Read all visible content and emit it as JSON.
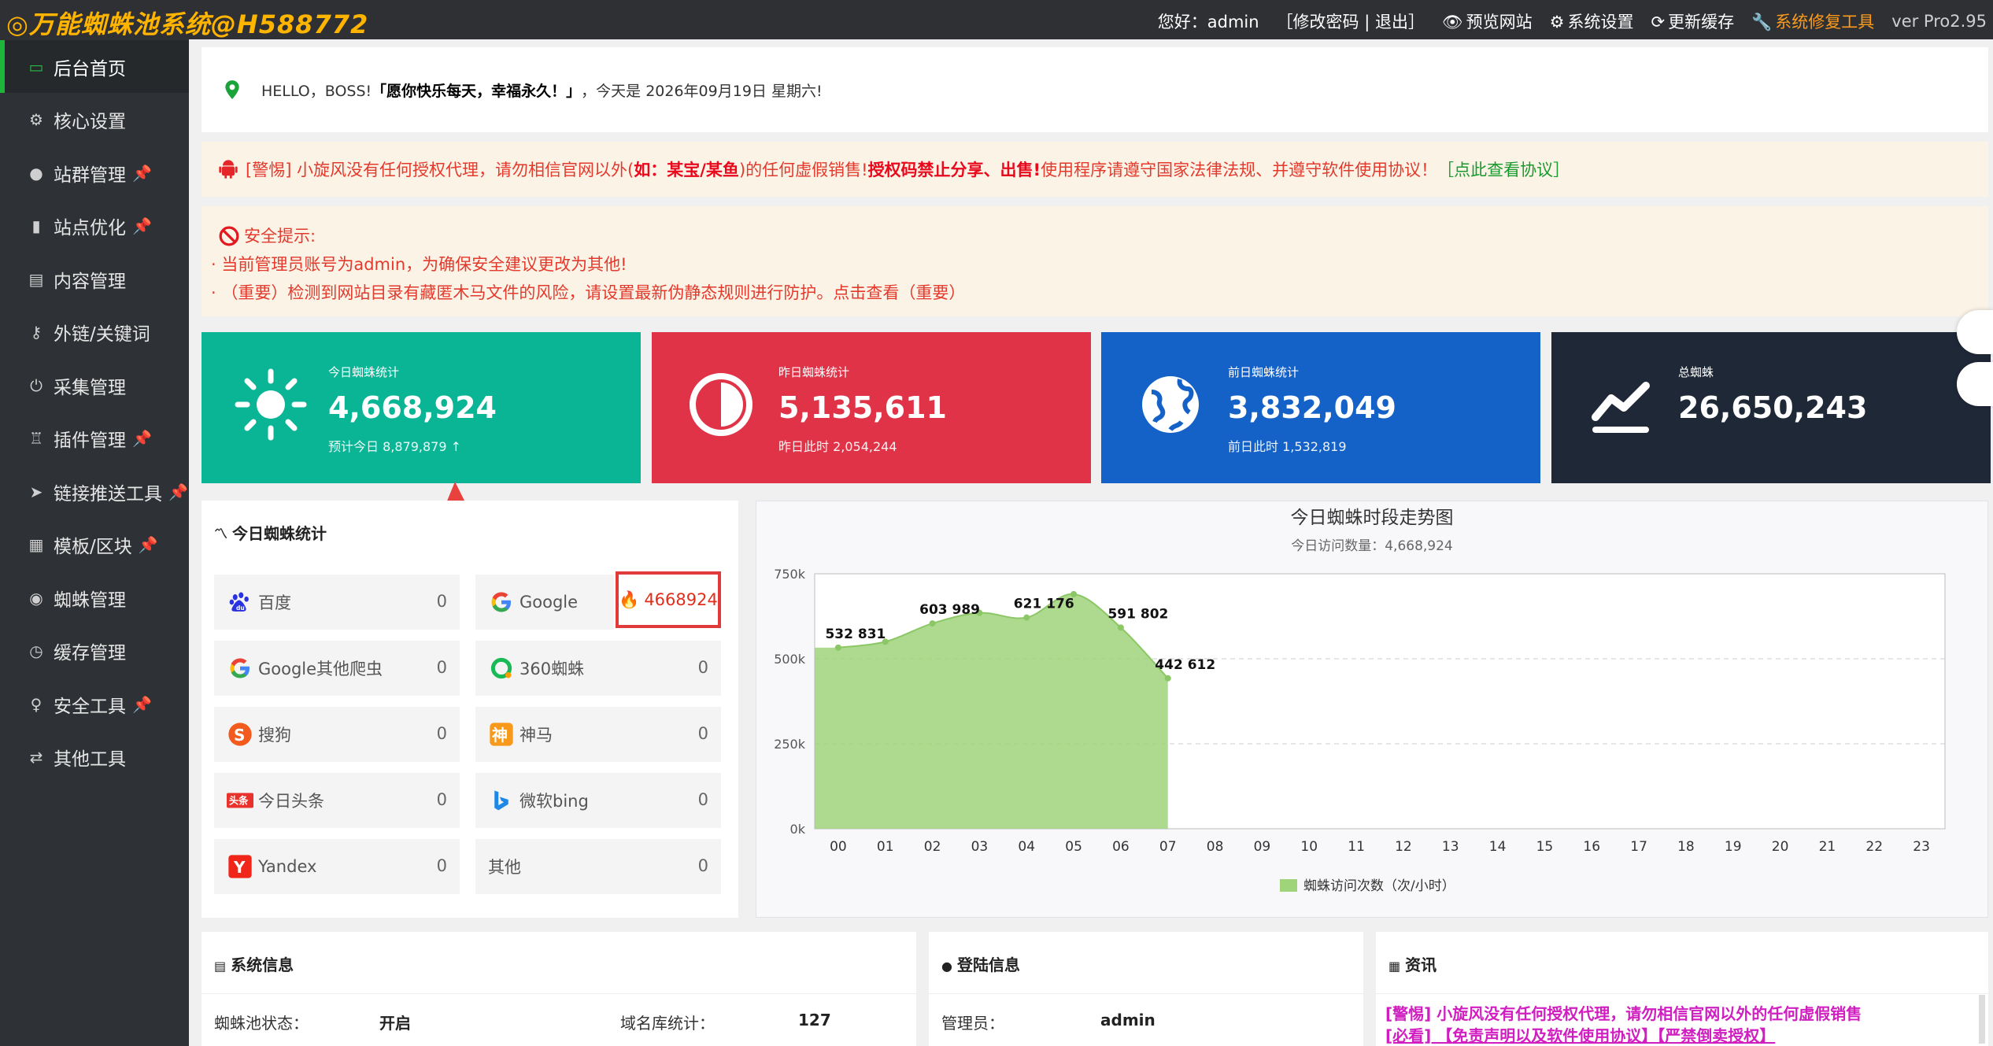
{
  "app": {
    "logo": "◎万能蜘蛛池系统@H588772",
    "greeting_user": "您好：admin",
    "account_links": "［修改密码 | 退出］",
    "preview": "预览网站",
    "settings": "系统设置",
    "refresh": "更新缓存",
    "repair": "系统修复工具",
    "version": "ver Pro2.95"
  },
  "sidebar": {
    "items": [
      {
        "label": "后台首页",
        "icon": "monitor-icon",
        "pinned": false
      },
      {
        "label": "核心设置",
        "icon": "gear-icon",
        "pinned": false
      },
      {
        "label": "站群管理",
        "icon": "user-icon",
        "pinned": true
      },
      {
        "label": "站点优化",
        "icon": "bar-chart-icon",
        "pinned": true
      },
      {
        "label": "内容管理",
        "icon": "document-icon",
        "pinned": false
      },
      {
        "label": "外链/关键词",
        "icon": "key-icon",
        "pinned": false
      },
      {
        "label": "采集管理",
        "icon": "plug-icon",
        "pinned": false
      },
      {
        "label": "插件管理",
        "icon": "trophy-icon",
        "pinned": true
      },
      {
        "label": "链接推送工具",
        "icon": "send-icon",
        "pinned": true
      },
      {
        "label": "模板/区块",
        "icon": "grid-icon",
        "pinned": true
      },
      {
        "label": "蜘蛛管理",
        "icon": "android-icon",
        "pinned": false
      },
      {
        "label": "缓存管理",
        "icon": "clock-icon",
        "pinned": false
      },
      {
        "label": "安全工具",
        "icon": "bulb-icon",
        "pinned": true
      },
      {
        "label": "其他工具",
        "icon": "shuffle-icon",
        "pinned": false
      }
    ]
  },
  "greeting": {
    "prefix": "HELLO，BOSS! ",
    "motto": "「愿你快乐每天，幸福永久！」",
    "date": "，今天是 2026年09月19日 星期六!"
  },
  "warning": {
    "a": "[警惕] 小旋风没有任何授权代理，请勿相信官网以外(",
    "b": "如：某宝/某鱼",
    "c": ")的任何虚假销售! ",
    "d": "授权码禁止分享、出售! ",
    "e": "使用程序请遵守国家法律法规、并遵守软件使用协议！",
    "link": "［点此查看协议］"
  },
  "safety": {
    "title": "安全提示:",
    "line1": "· 当前管理员账号为admin，为确保安全建议更改为其他!",
    "line2": "· （重要）检测到网站目录有藏匿木马文件的风险，请设置最新伪静态规则进行防护。点击查看（重要）"
  },
  "cards": [
    {
      "label": "今日蜘蛛统计",
      "value": "4,668,924",
      "sub": "预计今日 8,879,879 ↑",
      "color": "#0ab596",
      "icon": "sun-icon"
    },
    {
      "label": "昨日蜘蛛统计",
      "value": "5,135,611",
      "sub": "昨日此时 2,054,244",
      "color": "#e03348",
      "icon": "half-circle-icon"
    },
    {
      "label": "前日蜘蛛统计",
      "value": "3,832,049",
      "sub": "前日此时 1,532,819",
      "color": "#1461c8",
      "icon": "globe-icon"
    },
    {
      "label": "总蜘蛛",
      "value": "26,650,243",
      "sub": "",
      "color": "#1f2837",
      "icon": "trend-icon"
    }
  ],
  "spiders": {
    "title": "今日蜘蛛统计",
    "items": [
      {
        "name": "百度",
        "count": "0"
      },
      {
        "name": "Google",
        "count": "4668924"
      },
      {
        "name": "Google其他爬虫",
        "count": "0"
      },
      {
        "name": "360蜘蛛",
        "count": "0"
      },
      {
        "name": "搜狗",
        "count": "0"
      },
      {
        "name": "神马",
        "count": "0"
      },
      {
        "name": "今日头条",
        "count": "0"
      },
      {
        "name": "微软bing",
        "count": "0"
      },
      {
        "name": "Yandex",
        "count": "0"
      },
      {
        "name": "其他",
        "count": "0"
      }
    ]
  },
  "chart_data": {
    "type": "area",
    "title": "今日蜘蛛时段走势图",
    "subtitle": "今日访问数量：4,668,924",
    "x": [
      "00",
      "01",
      "02",
      "03",
      "04",
      "05",
      "06",
      "07",
      "08",
      "09",
      "10",
      "11",
      "12",
      "13",
      "14",
      "15",
      "16",
      "17",
      "18",
      "19",
      "20",
      "21",
      "22",
      "23"
    ],
    "series": [
      {
        "name": "蜘蛛访问次数（次/小时）",
        "values": [
          532831,
          550000,
          603989,
          635000,
          621176,
          690000,
          591802,
          442612
        ],
        "color": "#9fd47a"
      }
    ],
    "point_labels": [
      {
        "index": 0,
        "text": "532 831"
      },
      {
        "index": 2,
        "text": "603 989"
      },
      {
        "index": 4,
        "text": "621 176"
      },
      {
        "index": 6,
        "text": "591 802"
      },
      {
        "index": 7,
        "text": "442 612"
      }
    ],
    "yticks": [
      "750k",
      "500k",
      "250k",
      "0k"
    ],
    "ylim": [
      0,
      750000
    ]
  },
  "system": {
    "title": "系统信息",
    "status_key": "蜘蛛池状态：",
    "status_val": "开启",
    "domain_key": "域名库统计：",
    "domain_val": "127"
  },
  "login": {
    "title": "登陆信息",
    "admin_key": "管理员：",
    "admin_val": "admin"
  },
  "news": {
    "title": "资讯",
    "line1": "[警惕] 小旋风没有任何授权代理，请勿相信官网以外的任何虚假销售",
    "line2": "[必看] 【免责声明以及软件使用协议】【严禁倒卖授权】"
  }
}
